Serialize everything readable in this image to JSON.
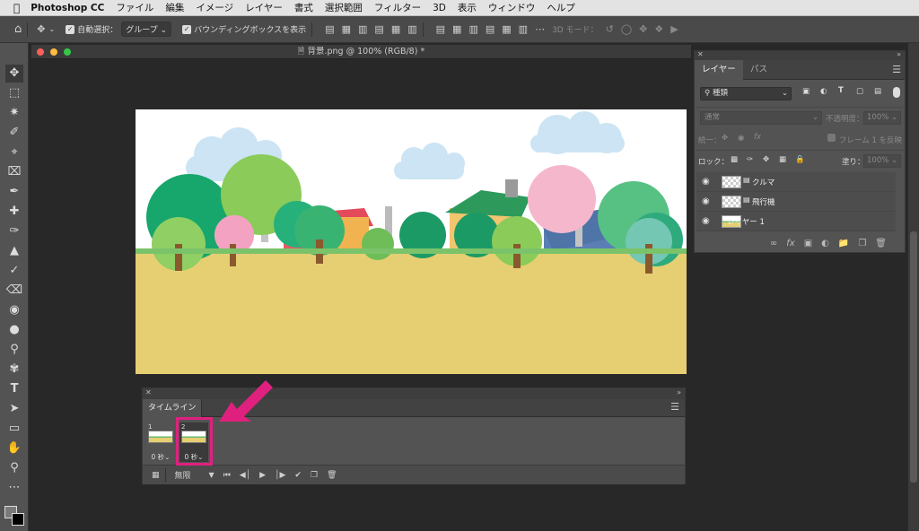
{
  "menubar": {
    "apple_icon": "apple-icon",
    "items": [
      "Photoshop CC",
      "ファイル",
      "編集",
      "イメージ",
      "レイヤー",
      "書式",
      "選択範囲",
      "フィルター",
      "3D",
      "表示",
      "ウィンドウ",
      "ヘルプ"
    ]
  },
  "options": {
    "auto_select_label": "自動選択：",
    "auto_select_value": "グループ",
    "bbox_label": "バウンディングボックスを表示",
    "mode3d_label": "3D モード："
  },
  "document": {
    "title": "背景.png @ 100% (RGB/8) *"
  },
  "timeline": {
    "tab": "タイムライン",
    "frames": [
      {
        "number": "1",
        "delay": "0 秒"
      },
      {
        "number": "2",
        "delay": "0 秒"
      }
    ],
    "loop": "無限",
    "selected_frame": 2
  },
  "layers_panel": {
    "tabs": [
      "レイヤー",
      "パス"
    ],
    "filter_value": "種類",
    "blend_mode": "通常",
    "opacity_label": "不透明度：",
    "opacity_value": "100%",
    "unify_label": "統一：",
    "propagate_label": "フレーム 1 を反映",
    "lock_label": "ロック：",
    "fill_label": "塗り：",
    "fill_value": "100%",
    "layers": [
      {
        "name": "クルマ"
      },
      {
        "name": "飛行機"
      },
      {
        "name": "レイヤー 1"
      }
    ]
  },
  "colors": {
    "highlight": "#e0207f",
    "ground": "#e6cf72",
    "sky_cloud": "#cce4f4"
  }
}
